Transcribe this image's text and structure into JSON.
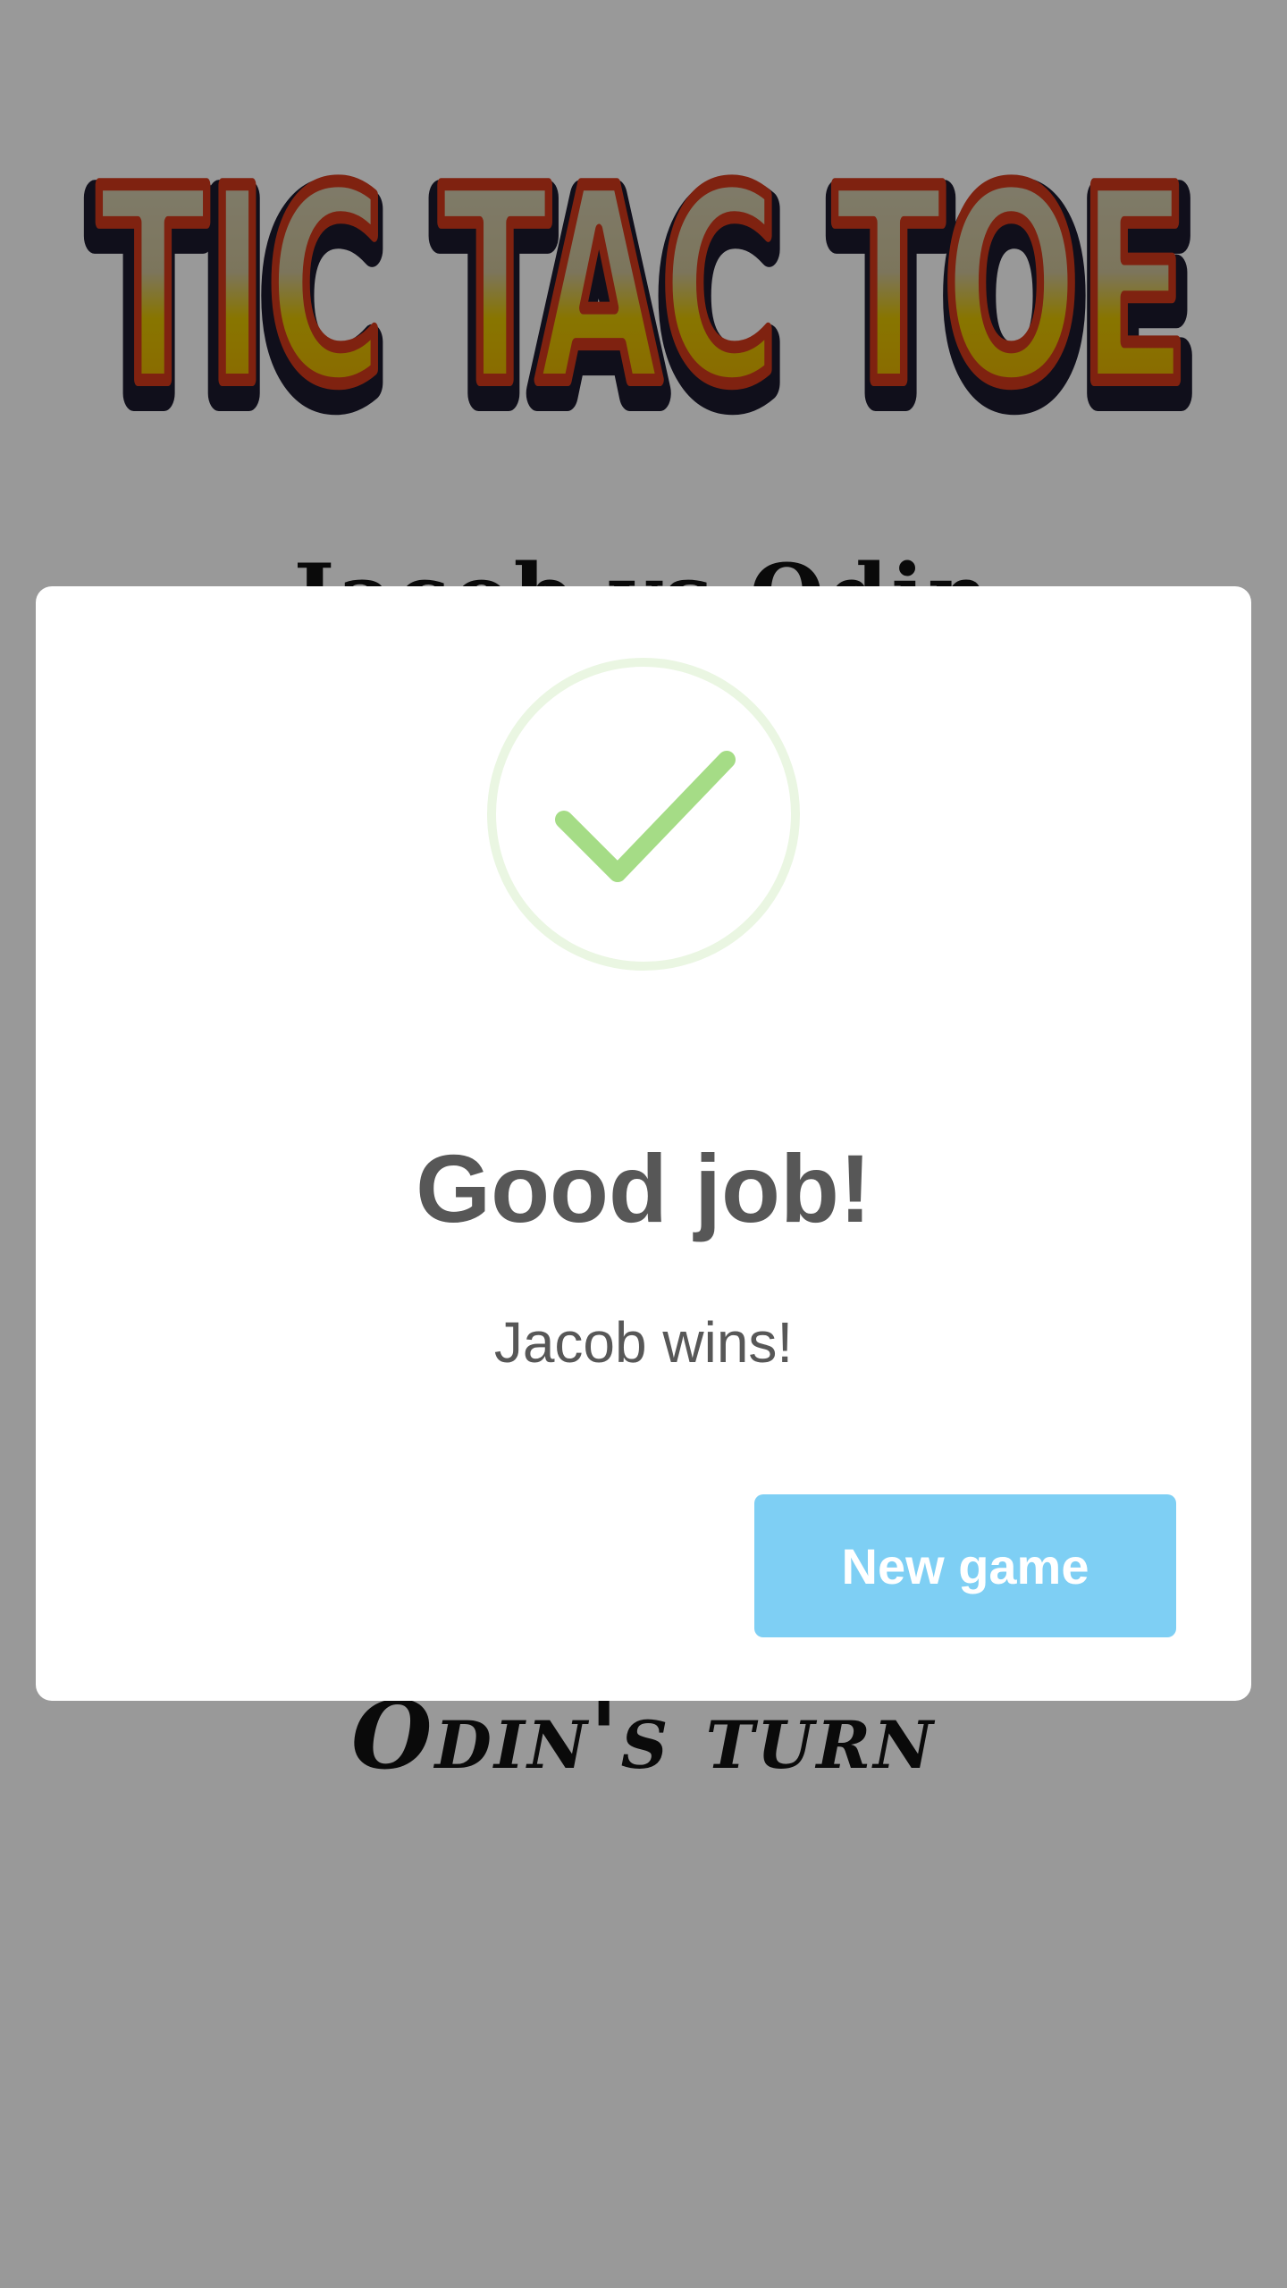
{
  "logo": {
    "text": "TIC TAC TOE",
    "colors": {
      "fill_top": "#c9c2a8",
      "fill_bottom": "#e6a800",
      "outline": "#d43a1c",
      "shadow": "#1c1a2e"
    }
  },
  "board": {
    "heading": "Jacob vs Odin"
  },
  "status": {
    "turn_text": "Odin's turn"
  },
  "modal": {
    "icon": "success-checkmark-icon",
    "title": "Good job!",
    "text": "Jacob wins!",
    "confirm_label": "New game",
    "colors": {
      "check": "#a5dc86",
      "ring": "#eaf6e2",
      "button": "#7ecff4",
      "text": "#575757"
    }
  }
}
